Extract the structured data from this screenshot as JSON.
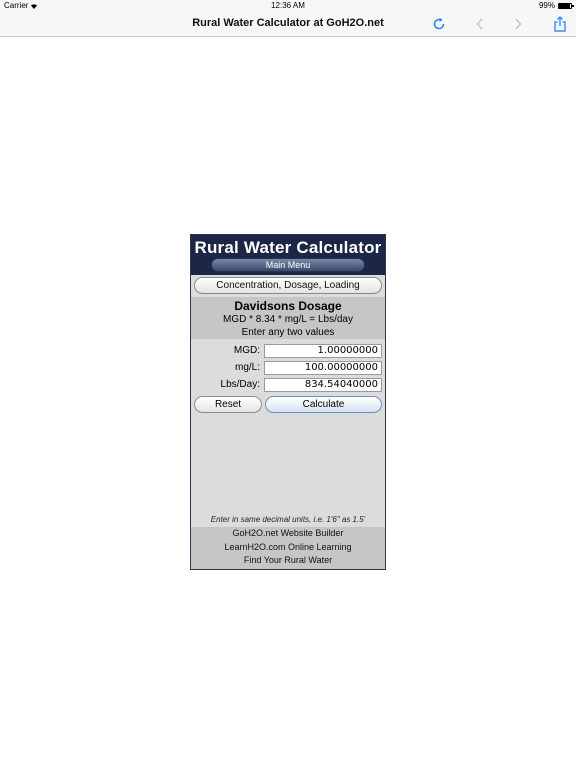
{
  "status_bar": {
    "carrier": "Carrier",
    "time": "12:36 AM",
    "battery": "99%"
  },
  "nav": {
    "title": "Rural Water Calculator at GoH2O.net"
  },
  "calculator": {
    "app_title": "Rural Water Calculator",
    "main_menu": "Main Menu",
    "category": "Concentration, Dosage, Loading",
    "calc_name": "Davidsons Dosage",
    "formula": "MGD * 8.34 * mg/L = Lbs/day",
    "hint": "Enter any two values",
    "fields": [
      {
        "label": "MGD:",
        "value": "1.00000000"
      },
      {
        "label": "mg/L:",
        "value": "100.00000000"
      },
      {
        "label": "Lbs/Day:",
        "value": "834.54040000"
      }
    ],
    "reset_label": "Reset",
    "calculate_label": "Calculate",
    "note": "Enter in same decimal units, i.e. 1'6\" as 1.5'",
    "links": [
      "GoH2O.net Website Builder",
      "LearnH2O.com Online Learning",
      "Find Your Rural Water"
    ]
  },
  "colors": {
    "header_bg": "#1c2745",
    "panel_bg": "#dcdcdc",
    "ios_blue": "#1a7cf5"
  }
}
